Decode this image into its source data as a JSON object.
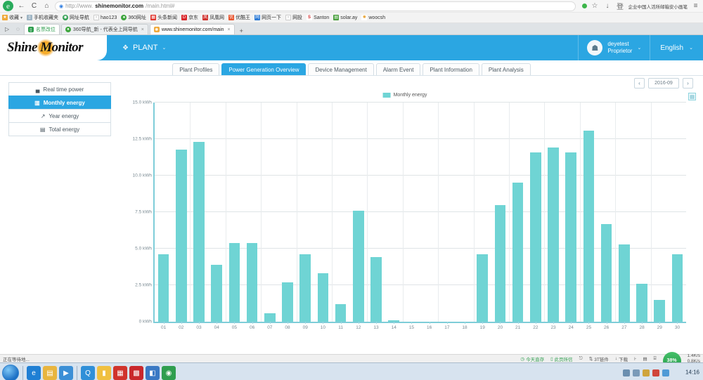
{
  "browser": {
    "url_prefix": "http://www.",
    "url_domain": "shinemonitor.com",
    "url_path": "/main.html#",
    "back_icon": "←",
    "reload_icon": "C",
    "home_icon": "⌂",
    "lock_icon": "◉",
    "star_icon": "☆",
    "download_icon": "↓",
    "menu_icon": "≡",
    "user_icon": "登",
    "right_label": "企业中国人活所邮箱安小画笔",
    "bookmarks": [
      {
        "label": "收藏",
        "color": "#f0a93a",
        "glyph": "★"
      },
      {
        "label": "手机收藏夹",
        "color": "#9fb5c4",
        "glyph": "▯"
      },
      {
        "label": "网址导航",
        "color": "#2f9e4f",
        "glyph": "◉"
      },
      {
        "label": "hao123",
        "color": "#ffffff",
        "glyph": "▫"
      },
      {
        "label": "360网址",
        "color": "#3fa63f",
        "glyph": "●"
      },
      {
        "label": "头条新闻",
        "color": "#e0342c",
        "glyph": "▦"
      },
      {
        "label": "京东",
        "color": "#d9262a",
        "glyph": "D"
      },
      {
        "label": "凤凰网",
        "color": "#d0312d",
        "glyph": "凤"
      },
      {
        "label": "优酷王",
        "color": "#e8552f",
        "glyph": "优"
      },
      {
        "label": "网页一下",
        "color": "#2b7ad6",
        "glyph": "网"
      },
      {
        "label": "网投",
        "color": "#ffffff",
        "glyph": "▫"
      },
      {
        "label": "Santon",
        "color": "#d42a2a",
        "glyph": "S"
      },
      {
        "label": "solar.ay",
        "color": "#4aa03f",
        "glyph": "▤"
      },
      {
        "label": "woocsh",
        "color": "#e8a02f",
        "glyph": "✺"
      }
    ],
    "tabs": [
      {
        "label": "名票改位",
        "favicon_color": "#2f9e4f",
        "favicon_glyph": "▯",
        "active": false,
        "pinned": true
      },
      {
        "label": "360导航_新 - 代表全上网导航",
        "favicon_color": "#3fa63f",
        "favicon_glyph": "●",
        "active": false,
        "pinned": false
      },
      {
        "label": "www.shinemonitor.com/main",
        "favicon_color": "#f0a93a",
        "favicon_glyph": "✺",
        "active": true,
        "pinned": false
      }
    ],
    "new_tab_glyph": "+",
    "tab_list_glyph": "▷",
    "tab_cloud_glyph": "◌"
  },
  "app": {
    "logo_text": "Shine Monitor",
    "plant_label": "PLANT",
    "plant_icon": "solar-panel-icon",
    "user_name": "deyetest",
    "user_role": "Proprietor",
    "language": "English",
    "avatar_glyph": "☗",
    "caret_glyph": "⌄",
    "accent_color": "#2ba6e2"
  },
  "page_tabs": [
    {
      "label": "Plant Profiles",
      "active": false
    },
    {
      "label": "Power Generation Overview",
      "active": true
    },
    {
      "label": "Device Management",
      "active": false
    },
    {
      "label": "Alarm Event",
      "active": false
    },
    {
      "label": "Plant Information",
      "active": false
    },
    {
      "label": "Plant Analysis",
      "active": false
    }
  ],
  "sidebar": {
    "items": [
      {
        "label": "Real time power",
        "icon": "bar-chart-icon",
        "glyph": "▄",
        "active": false
      },
      {
        "label": "Monthly energy",
        "icon": "bar-chart-icon",
        "glyph": "▥",
        "active": true
      },
      {
        "label": "Year energy",
        "icon": "line-chart-icon",
        "glyph": "↗",
        "active": false
      },
      {
        "label": "Total energy",
        "icon": "table-icon",
        "glyph": "▤",
        "active": false
      }
    ]
  },
  "date_nav": {
    "prev_glyph": "‹",
    "next_glyph": "›",
    "value": "2016-09"
  },
  "chart_toolbox": {
    "save_icon": "save-image-icon",
    "save_glyph": "▤"
  },
  "chart_data": {
    "type": "bar",
    "title": "",
    "legend": [
      "Monthly energy"
    ],
    "legend_position": "top-center",
    "series_color": "#6fd4d4",
    "xlabel": "",
    "ylabel": "",
    "ylim": [
      0,
      15
    ],
    "yticks": [
      0,
      2.5,
      5,
      7.5,
      10,
      12.5,
      15
    ],
    "ytick_labels": [
      "0 kWh",
      "2.5 kWh",
      "5.0 kWh",
      "7.5 kWh",
      "10.0 kWh",
      "12.5 kWh",
      "15.0 kWh"
    ],
    "grid": true,
    "categories": [
      "01",
      "02",
      "03",
      "04",
      "05",
      "06",
      "07",
      "08",
      "09",
      "10",
      "11",
      "12",
      "13",
      "14",
      "15",
      "16",
      "17",
      "18",
      "19",
      "20",
      "21",
      "22",
      "23",
      "24",
      "25",
      "26",
      "27",
      "28",
      "29",
      "30"
    ],
    "series": [
      {
        "name": "Monthly energy",
        "values": [
          4.6,
          11.8,
          12.3,
          3.9,
          5.4,
          5.4,
          0.6,
          2.7,
          4.6,
          3.3,
          1.2,
          7.6,
          4.4,
          0.1,
          0,
          0,
          0,
          0,
          4.6,
          8.0,
          9.5,
          11.6,
          11.9,
          11.6,
          13.1,
          6.7,
          5.3,
          2.6,
          1.5,
          4.6
        ]
      }
    ]
  },
  "status_strip": {
    "left_label": "正在等待地...",
    "items": [
      {
        "label": "今天直存",
        "glyph": "◷"
      },
      {
        "label": "此页所信",
        "glyph": "▯"
      },
      {
        "label": "",
        "glyph": "⎋"
      },
      {
        "label": "3T链件",
        "glyph": "⇅"
      },
      {
        "label": "下载",
        "glyph": "↓"
      },
      {
        "label": "",
        "glyph": "⊦"
      },
      {
        "label": "",
        "glyph": "▤"
      },
      {
        "label": "",
        "glyph": "⌸"
      }
    ],
    "battery_percent": "38%",
    "speed_up": "1.4K/s",
    "speed_down": "0.8K/s"
  },
  "taskbar": {
    "clock_time": "14:16",
    "start_icon": "start-orb-icon",
    "icons": [
      {
        "name": "ie-icon",
        "glyph": "e",
        "color": "#1f7fd4"
      },
      {
        "name": "explorer-icon",
        "glyph": "▤",
        "color": "#e8b53f"
      },
      {
        "name": "media-icon",
        "glyph": "▶",
        "color": "#3b8fd6"
      },
      {
        "name": "qq-icon",
        "glyph": "Q",
        "color": "#2f8fd8"
      },
      {
        "name": "folder-icon",
        "glyph": "▮",
        "color": "#f0c040"
      },
      {
        "name": "app-red-icon",
        "glyph": "▦",
        "color": "#d0342c"
      },
      {
        "name": "app-red2-icon",
        "glyph": "▩",
        "color": "#c9282c"
      },
      {
        "name": "app-blue-icon",
        "glyph": "◧",
        "color": "#3a79c4"
      },
      {
        "name": "browser-icon",
        "glyph": "◉",
        "color": "#2f9e4f"
      }
    ],
    "tray_icons": [
      {
        "name": "network-icon",
        "color": "#6b8fb0"
      },
      {
        "name": "volume-icon",
        "color": "#7a9ab8"
      },
      {
        "name": "shield-icon",
        "color": "#cfa43c"
      },
      {
        "name": "chat-icon",
        "color": "#d0453c"
      },
      {
        "name": "cloud-icon",
        "color": "#4f9ad6"
      }
    ]
  }
}
